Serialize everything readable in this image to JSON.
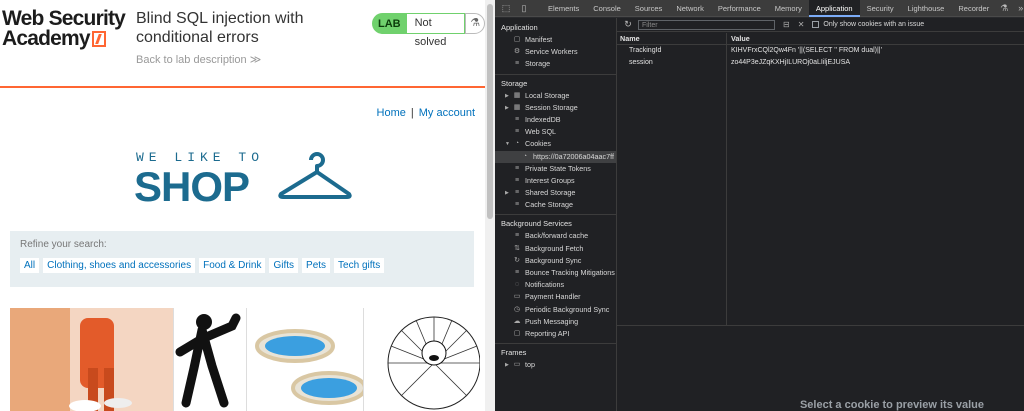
{
  "site": {
    "logo_line1": "Web Security",
    "logo_line2": "Academy",
    "lab_title": "Blind SQL injection with conditional errors",
    "back_link": "Back to lab description",
    "lab_label": "LAB",
    "lab_status": "Not solved",
    "nav_home": "Home",
    "nav_sep": "|",
    "nav_account": "My account",
    "hero_small": "WE LIKE TO",
    "hero_big": "SHOP",
    "refine_label": "Refine your search:",
    "filters": [
      "All",
      "Clothing, shoes and accessories",
      "Food & Drink",
      "Gifts",
      "Pets",
      "Tech gifts"
    ],
    "accent_color": "#ff6633",
    "link_color": "#0071bc"
  },
  "devtools": {
    "tabs": [
      "Elements",
      "Console",
      "Sources",
      "Network",
      "Performance",
      "Memory",
      "Application",
      "Security",
      "Lighthouse",
      "Recorder"
    ],
    "active_tab": "Application",
    "sidebar": {
      "application_header": "Application",
      "application_items": [
        "Manifest",
        "Service Workers",
        "Storage"
      ],
      "storage_header": "Storage",
      "storage_items": [
        "Local Storage",
        "Session Storage",
        "IndexedDB",
        "Web SQL",
        "Cookies"
      ],
      "cookie_origin": "https://0a72006a04aac7ff",
      "storage_items_after": [
        "Private State Tokens",
        "Interest Groups",
        "Shared Storage",
        "Cache Storage"
      ],
      "bg_header": "Background Services",
      "bg_items": [
        "Back/forward cache",
        "Background Fetch",
        "Background Sync",
        "Bounce Tracking Mitigations",
        "Notifications",
        "Payment Handler",
        "Periodic Background Sync",
        "Push Messaging",
        "Reporting API"
      ],
      "frames_header": "Frames",
      "frames_items": [
        "top"
      ]
    },
    "toolbar": {
      "filter_placeholder": "Filter",
      "only_issue_label": "Only show cookies with an issue"
    },
    "table": {
      "col_name": "Name",
      "col_value": "Value",
      "rows": [
        {
          "name": "TrackingId",
          "value": "KIHVFrxCQl2Qw4Fn '||(SELECT '' FROM dual)||'"
        },
        {
          "name": "session",
          "value": "zo44P3eJZqKXHjILUROj0aLIiljEJUSA"
        }
      ]
    },
    "preview_text": "Select a cookie to preview its value"
  }
}
